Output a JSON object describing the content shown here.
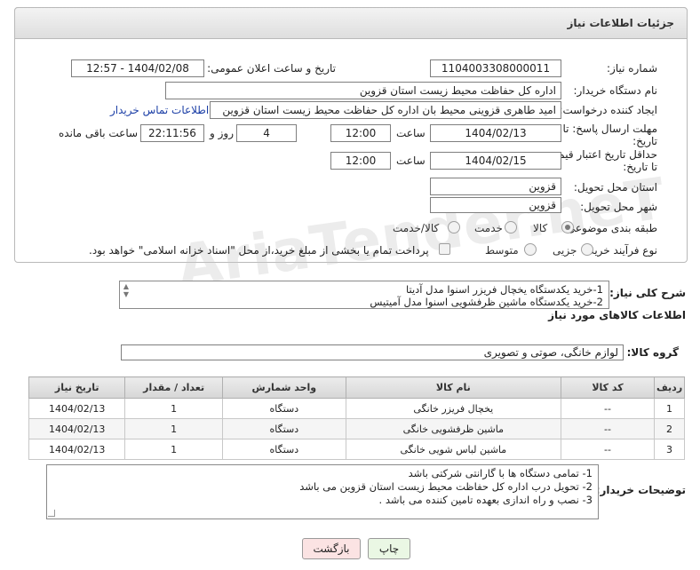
{
  "panel": {
    "title": "جزئیات اطلاعات نیاز"
  },
  "form": {
    "need_number_label": "شماره نیاز:",
    "need_number": "1104003308000011",
    "announce_label": "تاریخ و ساعت اعلان عمومی:",
    "announce_value": "1404/02/08 - 12:57",
    "buyer_org_label": "نام دستگاه خریدار:",
    "buyer_org": "اداره کل حفاظت محیط زیست استان قزوین",
    "creator_label": "ایجاد کننده درخواست:",
    "creator": "امید طاهری قزوینی محیط بان اداره کل حفاظت محیط زیست استان قزوین",
    "contact_link": "اطلاعات تماس خریدار",
    "deadline_label": "مهلت ارسال پاسخ: تا تاریخ:",
    "deadline_date": "1404/02/13",
    "time_label": "ساعت",
    "deadline_time": "12:00",
    "days_value": "4",
    "days_label": "روز و",
    "remaining_time": "22:11:56",
    "remaining_label": "ساعت باقی مانده",
    "validity_label": "حداقل تاریخ اعتبار قیمت: تا تاریخ:",
    "validity_date": "1404/02/15",
    "validity_time": "12:00",
    "province_label": "استان محل تحویل:",
    "province": "قزوین",
    "city_label": "شهر محل تحویل:",
    "city": "قزوین",
    "category_label": "طبقه بندی موضوعی:",
    "category_options": [
      "کالا",
      "خدمت",
      "کالا/خدمت"
    ],
    "process_label": "نوع فرآیند خرید :",
    "process_options": [
      "جزیی",
      "متوسط"
    ],
    "payment_note": "پرداخت تمام یا بخشی از مبلغ خرید،از محل \"اسناد خزانه اسلامی\" خواهد بود."
  },
  "description": {
    "label": "شرح کلی نیاز:",
    "line1": "1-خرید یکدستگاه یخچال فریزر اسنوا مدل آدیتا",
    "line2": "2-خرید یکدستگاه ماشین ظرفشویی اسنوا مدل آمیتیس"
  },
  "goods": {
    "section_title": "اطلاعات کالاهای مورد نیاز",
    "group_label": "گروه کالا:",
    "group_value": "لوازم خانگی، صوتی و تصویری",
    "columns": [
      "ردیف",
      "کد کالا",
      "نام کالا",
      "واحد شمارش",
      "تعداد / مقدار",
      "تاریخ نیاز"
    ],
    "rows": [
      {
        "idx": "1",
        "code": "--",
        "name": "یخچال فریزر خانگی",
        "unit": "دستگاه",
        "qty": "1",
        "date": "1404/02/13"
      },
      {
        "idx": "2",
        "code": "--",
        "name": "ماشین ظرفشویی خانگی",
        "unit": "دستگاه",
        "qty": "1",
        "date": "1404/02/13"
      },
      {
        "idx": "3",
        "code": "--",
        "name": "ماشین لباس شویی خانگی",
        "unit": "دستگاه",
        "qty": "1",
        "date": "1404/02/13"
      }
    ]
  },
  "buyer_notes": {
    "label": "توضیحات خریدار:",
    "line1": "1- تمامی دستگاه ها با گارانتی شرکتی باشد",
    "line2": "2- تحویل درب اداره کل حفاظت محیط زیست استان قزوین می باشد",
    "line3": "3- نصب و راه اندازی بعهده تامین کننده می باشد ."
  },
  "buttons": {
    "print": "چاپ",
    "back": "بازگشت"
  },
  "watermark": {
    "text": "AriaTender.neT"
  },
  "colors": {
    "back_button_bg": "#fbe3e3",
    "print_button_bg": "#eaf7e4",
    "link": "#1b3ea6"
  }
}
